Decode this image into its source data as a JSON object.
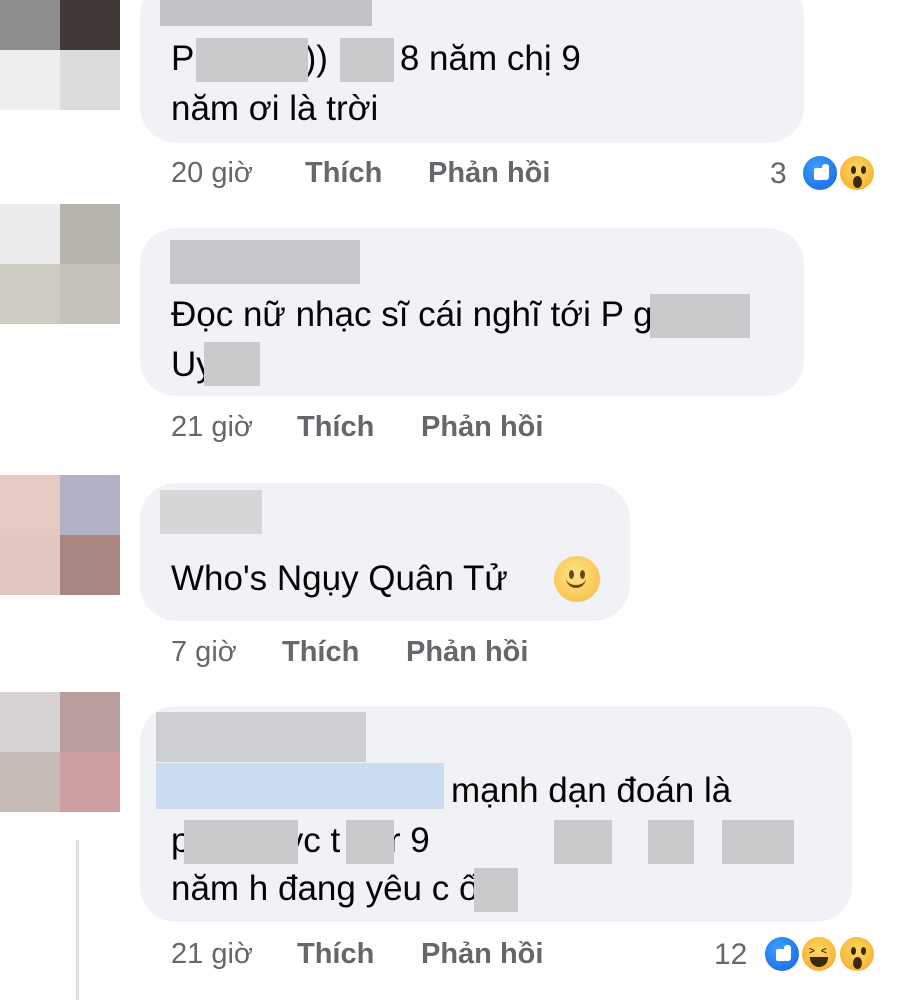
{
  "comments": [
    {
      "text_lines": [
        "P          Uy    à?:)) Em 8 năm chị 9",
        "năm ơi là trời"
      ],
      "time": "20 giờ",
      "like_label": "Thích",
      "reply_label": "Phản hồi",
      "reaction_count": "3",
      "reactions": [
        "like-icon",
        "wow-icon"
      ]
    },
    {
      "text_lines": [
        "Đọc nữ nhạc sĩ cái nghĩ tới P          g",
        "Uy     :))"
      ],
      "time": "21 giờ",
      "like_label": "Thích",
      "reply_label": "Phản hồi"
    },
    {
      "text_lines": [
        "Who's Ngụy Quân Tử"
      ],
      "time": "7 giờ",
      "like_label": "Thích",
      "reply_label": "Phản hồi",
      "emoji": "slightly-smiling-face-icon"
    },
    {
      "text_lines": [
        "mạnh dạn đoán là",
        "p                 u       ct nyc t       b        tr         9",
        "năm h đang yêu c     ố"
      ],
      "time": "21 giờ",
      "like_label": "Thích",
      "reply_label": "Phản hồi",
      "reaction_count": "12",
      "reactions": [
        "like-icon",
        "haha-icon",
        "wow-icon"
      ]
    }
  ]
}
